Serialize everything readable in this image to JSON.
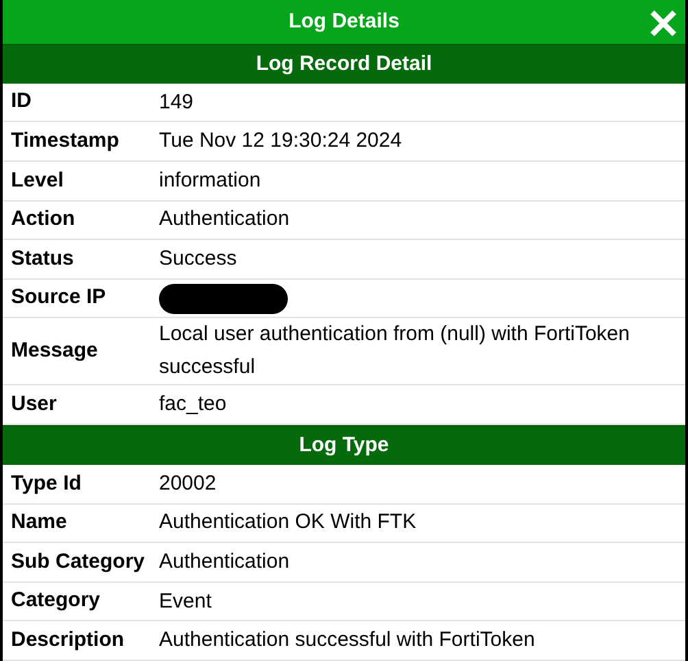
{
  "window": {
    "title": "Log Details"
  },
  "sections": [
    {
      "title": "Log Record Detail",
      "rows": [
        {
          "kind": "text",
          "label": "ID",
          "value": "149"
        },
        {
          "kind": "text",
          "label": "Timestamp",
          "value": "Tue Nov 12 19:30:24 2024"
        },
        {
          "kind": "text",
          "label": "Level",
          "value": "information"
        },
        {
          "kind": "text",
          "label": "Action",
          "value": "Authentication"
        },
        {
          "kind": "text",
          "label": "Status",
          "value": "Success"
        },
        {
          "kind": "redacted",
          "label": "Source IP"
        },
        {
          "kind": "text",
          "label": "Message",
          "value": "Local user authentication from (null) with FortiToken successful"
        },
        {
          "kind": "text",
          "label": "User",
          "value": "fac_teo"
        }
      ]
    },
    {
      "title": "Log Type",
      "rows": [
        {
          "kind": "text",
          "label": "Type Id",
          "value": "20002"
        },
        {
          "kind": "text",
          "label": "Name",
          "value": "Authentication OK With FTK"
        },
        {
          "kind": "text",
          "label": "Sub Category",
          "value": "Authentication"
        },
        {
          "kind": "text",
          "label": "Category",
          "value": "Event"
        },
        {
          "kind": "text",
          "label": "Description",
          "value": "Authentication successful with FortiToken"
        }
      ]
    }
  ]
}
